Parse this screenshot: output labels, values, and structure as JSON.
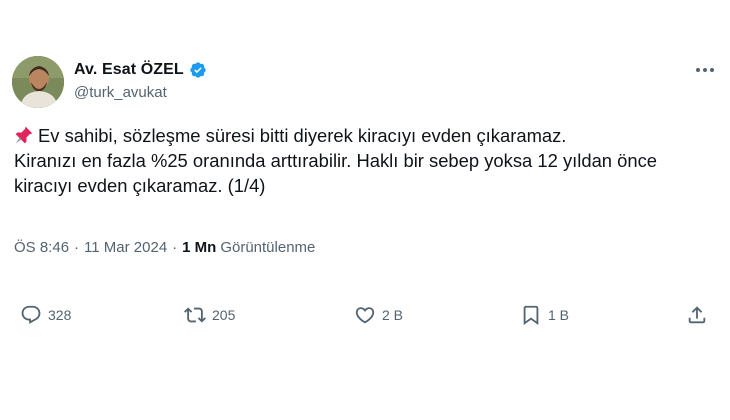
{
  "author": {
    "display_name": "Av. Esat ÖZEL",
    "handle": "@turk_avukat",
    "verified_icon": "verified-badge-icon",
    "avatar": "profile-avatar"
  },
  "tweet": {
    "emoji": "pushpin-icon",
    "text": "Ev sahibi, sözleşme süresi bitti diyerek kiracıyı evden çıkaramaz.\nKiranızı en fazla %25 oranında arttırabilir. Haklı bir sebep yoksa 12 yıldan önce kiracıyı evden çıkaramaz. (1/4)"
  },
  "meta": {
    "time": "ÖS 8:46",
    "separator": "·",
    "date": "11 Mar 2024",
    "views_count": "1 Mn",
    "views_label": "Görüntülenme"
  },
  "actions": {
    "reply": {
      "icon": "reply-icon",
      "count": "328"
    },
    "retweet": {
      "icon": "retweet-icon",
      "count": "205"
    },
    "like": {
      "icon": "heart-icon",
      "count": "2 B"
    },
    "bookmark": {
      "icon": "bookmark-icon",
      "count": "1 B"
    },
    "share": {
      "icon": "share-icon"
    }
  },
  "colors": {
    "text": "#0f1419",
    "secondary": "#536471",
    "verified": "#1d9bf0",
    "pin": "#e0245e",
    "background": "#ffffff"
  }
}
